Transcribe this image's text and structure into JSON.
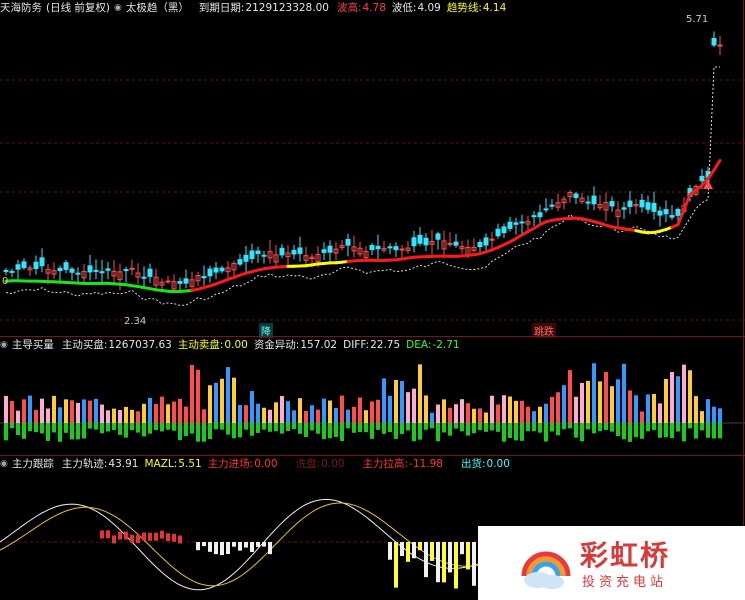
{
  "panel1": {
    "title": "天海防务",
    "period": "(日线 前复权)",
    "indicator": "太极趋（黑）",
    "expiry_label": "到期日期:",
    "expiry_value": "2129123328.00",
    "wave_high_label": "波高:",
    "wave_high_value": "4.78",
    "wave_low_label": "波低:",
    "wave_low_value": "4.09",
    "trend_label": "趋势线:",
    "trend_value": "4.14",
    "price_high": "5.71",
    "price_low": "2.34",
    "marker_zero": "0",
    "marker_zhang": "降",
    "marker_die": "跳跌"
  },
  "panel2": {
    "title": "主导买量",
    "buy_label": "主动买盘:",
    "buy_value": "1267037.63",
    "sell_label": "主动卖盘:",
    "sell_value": "0.00",
    "fund_label": "资金异动:",
    "fund_value": "157.02",
    "diff_label": "DIFF:",
    "diff_value": "22.75",
    "dea_label": "DEA:",
    "dea_value": "-2.71"
  },
  "panel3": {
    "title": "主力跟踪",
    "track_label": "主力轨迹:",
    "track_value": "43.91",
    "mazl_label": "MAZL:",
    "mazl_value": "5.51",
    "enter_label": "主力进场:",
    "enter_value": "0.00",
    "wash_label": "洗盘:",
    "wash_value": "0.00",
    "pull_label": "主力拉高:",
    "pull_value": "-11.98",
    "ship_label": "出货:",
    "ship_value": "0.00"
  },
  "watermark": {
    "name": "彩虹桥",
    "slogan": "投资充电站"
  },
  "colors": {
    "up": "#ff4d4d",
    "down": "#33e6ff",
    "trend_red": "#ff1a1a",
    "trend_green": "#19e619",
    "trend_yellow": "#ffff00",
    "label_yellow": "#ffff00",
    "label_red": "#ff3333",
    "label_cyan": "#33ffff",
    "label_green": "#33ff33"
  }
}
